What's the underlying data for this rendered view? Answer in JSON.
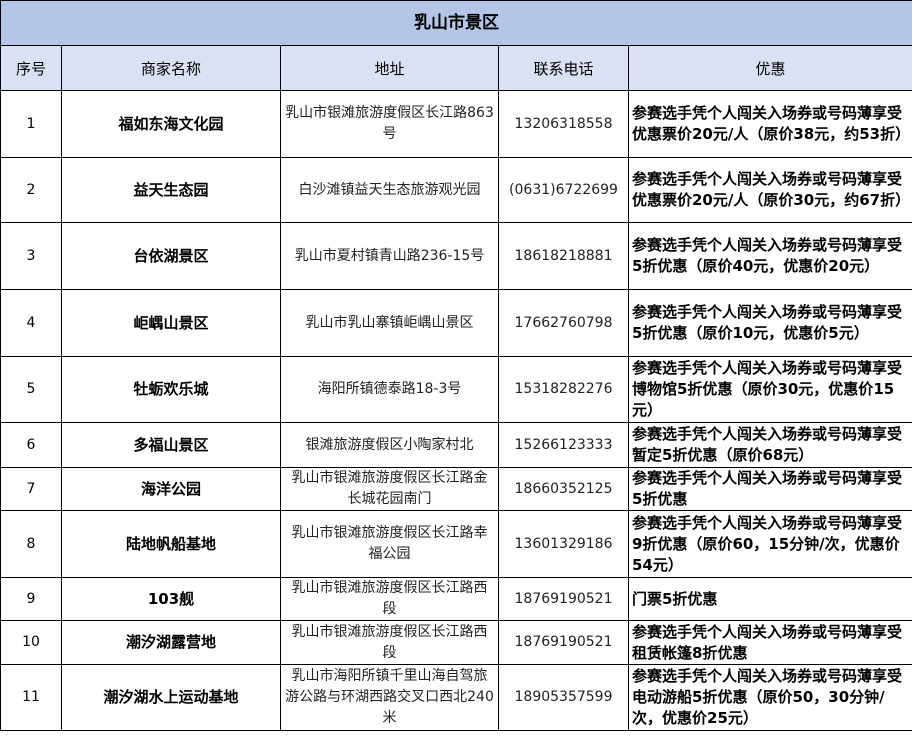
{
  "title": "乳山市景区",
  "headers": {
    "index": "序号",
    "name": "商家名称",
    "address": "地址",
    "phone": "联系电话",
    "offer": "优惠"
  },
  "rows": [
    {
      "index": "1",
      "name": "福如东海文化园",
      "address": "乳山市银滩旅游度假区长江路863号",
      "phone": "13206318558",
      "offer": "参赛选手凭个人闯关入场券或号码薄享受优惠票价20元/人（原价38元，约53折）"
    },
    {
      "index": "2",
      "name": "益天生态园",
      "address": "白沙滩镇益天生态旅游观光园",
      "phone": "(0631)6722699",
      "offer": "参赛选手凭个人闯关入场券或号码薄享受优惠票价20元/人（原价30元，约67折）"
    },
    {
      "index": "3",
      "name": "台依湖景区",
      "address": "乳山市夏村镇青山路236-15号",
      "phone": "18618218881",
      "offer": "参赛选手凭个人闯关入场券或号码薄享受5折优惠（原价40元，优惠价20元）"
    },
    {
      "index": "4",
      "name": "岠嵎山景区",
      "address": "乳山市乳山寨镇岠嵎山景区",
      "phone": "17662760798",
      "offer": "参赛选手凭个人闯关入场券或号码薄享受5折优惠（原价10元，优惠价5元）"
    },
    {
      "index": "5",
      "name": "牡蛎欢乐城",
      "address": "海阳所镇德泰路18-3号",
      "phone": "15318282276",
      "offer": "参赛选手凭个人闯关入场券或号码薄享受博物馆5折优惠（原价30元，优惠价15元）"
    },
    {
      "index": "6",
      "name": "多福山景区",
      "address": "银滩旅游度假区小陶家村北",
      "phone": "15266123333",
      "offer": "参赛选手凭个人闯关入场券或号码薄享受暂定5折优惠（原价68元）"
    },
    {
      "index": "7",
      "name": "海洋公园",
      "address": "乳山市银滩旅游度假区长江路金长城花园南门",
      "phone": "18660352125",
      "offer": "参赛选手凭个人闯关入场券或号码薄享受5折优惠"
    },
    {
      "index": "8",
      "name": "陆地帆船基地",
      "address": "乳山市银滩旅游度假区长江路幸福公园",
      "phone": "13601329186",
      "offer": "参赛选手凭个人闯关入场券或号码薄享受9折优惠（原价60，15分钟/次，优惠价54元）"
    },
    {
      "index": "9",
      "name": "103舰",
      "address": "乳山市银滩旅游度假区长江路西段",
      "phone": "18769190521",
      "offer": "门票5折优惠"
    },
    {
      "index": "10",
      "name": "潮汐湖露营地",
      "address": "乳山市银滩旅游度假区长江路西段",
      "phone": "18769190521",
      "offer": "参赛选手凭个人闯关入场券或号码薄享受租赁帐篷8折优惠"
    },
    {
      "index": "11",
      "name": "潮汐湖水上运动基地",
      "address": "乳山市海阳所镇千里山海自驾旅游公路与环湖西路交叉口西北240米",
      "phone": "18905357599",
      "offer": "参赛选手凭个人闯关入场券或号码薄享受电动游船5折优惠（原价50，30分钟/次，优惠价25元）"
    }
  ]
}
